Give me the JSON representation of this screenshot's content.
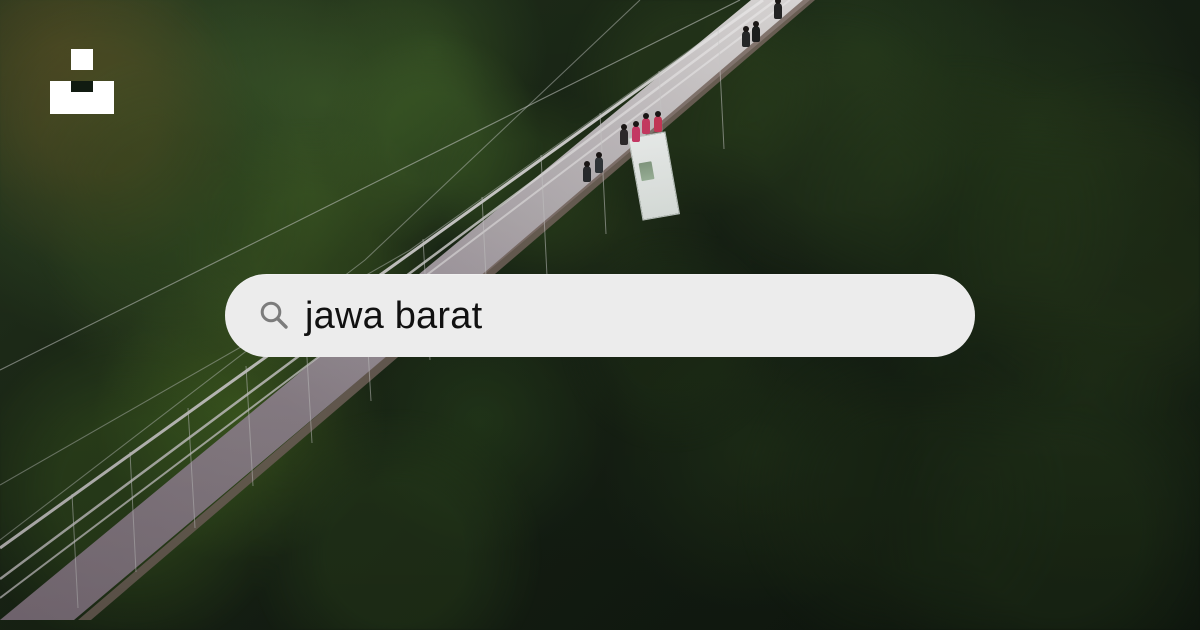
{
  "branding": {
    "logo_icon": "unsplash-logo-icon"
  },
  "search": {
    "icon": "search-icon",
    "query": "jawa barat"
  },
  "colors": {
    "search_background": "#ececec",
    "search_text": "#111111",
    "logo": "#ffffff"
  }
}
